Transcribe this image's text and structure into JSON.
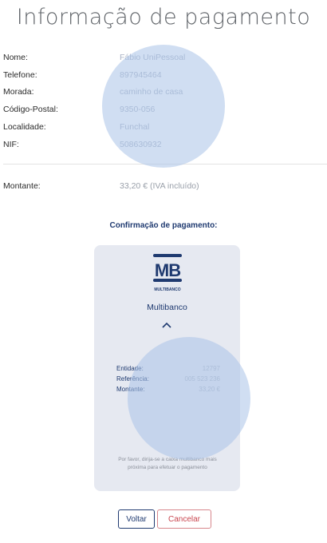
{
  "title": "Informação de pagamento",
  "customer": [
    {
      "label": "Nome:",
      "value": "Fábio UniPessoal"
    },
    {
      "label": "Telefone:",
      "value": "897945464"
    },
    {
      "label": "Morada:",
      "value": "caminho de casa"
    },
    {
      "label": "Código-Postal:",
      "value": "9350-056"
    },
    {
      "label": "Localidade:",
      "value": "Funchal"
    },
    {
      "label": "NIF:",
      "value": "508630932"
    }
  ],
  "amount": {
    "label": "Montante:",
    "value": "33,20 € (IVA incluído)"
  },
  "confirmation": {
    "title": "Confirmação de pagamento:",
    "method_logo_icon": "multibanco-mb-logo",
    "method_logo_text": "MB",
    "method_logo_subtext": "MULTIBANCO",
    "method_name": "Multibanco",
    "collapse_icon": "chevron-up-icon",
    "details": [
      {
        "label": "Entidade:",
        "value": "12797"
      },
      {
        "label": "Referência:",
        "value": "005 523 236"
      },
      {
        "label": "Montante:",
        "value": "33,20 €"
      }
    ],
    "note": "Por favor, dirija-se a caixa multibanco mais próxima para efetuar o pagamento"
  },
  "buttons": {
    "back": "Voltar",
    "cancel": "Cancelar"
  },
  "colors": {
    "navy": "#1f3a70",
    "cancel_red": "#c9454e",
    "card_bg": "#e6e9f1",
    "overlay_circle": "#aac3e8"
  }
}
